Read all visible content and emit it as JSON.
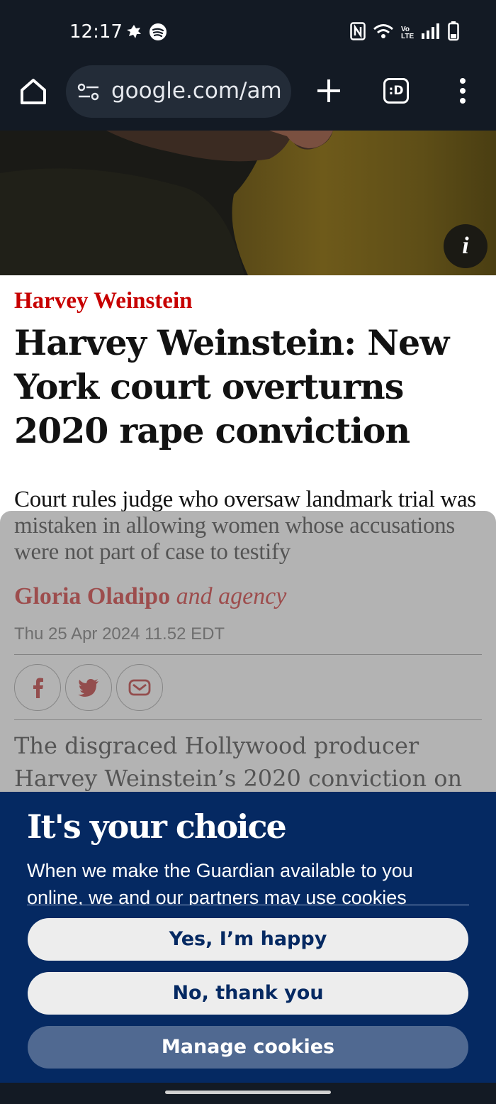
{
  "status_bar": {
    "time": "12:17",
    "icons_left": [
      "notification-icon",
      "spotify-icon"
    ],
    "icons_right": [
      "nfc-icon",
      "wifi-icon",
      "volte-icon",
      "signal-icon",
      "battery-icon"
    ],
    "volte_text": "Vo LTE"
  },
  "browser": {
    "url": "google.com/amp/",
    "tabs_label": ":D"
  },
  "article": {
    "kicker": "Harvey Weinstein",
    "headline": "Harvey Weinstein: New York court overturns 2020 rape conviction",
    "standfirst": "Court rules judge who oversaw landmark trial was mistaken in allowing women whose accusations were not part of case to testify",
    "author": "Gloria Oladipo",
    "author_suffix": " and agency",
    "date": "Thu 25 Apr 2024 11.52 EDT",
    "body": "The disgraced Hollywood producer Harvey Weinstein’s 2020 conviction on",
    "share_icons": [
      "facebook-icon",
      "twitter-icon",
      "email-icon"
    ]
  },
  "hero": {
    "info_label": "i"
  },
  "consent": {
    "title": "It's your choice",
    "body": "When we make the Guardian available to you online, we and our partners may use cookies",
    "yes_label": "Yes, I’m happy",
    "no_label": "No, thank you",
    "manage_label": "Manage cookies"
  },
  "colors": {
    "guardian_red": "#c70000",
    "guardian_blue": "#052962",
    "chrome_bg": "#131a24"
  }
}
